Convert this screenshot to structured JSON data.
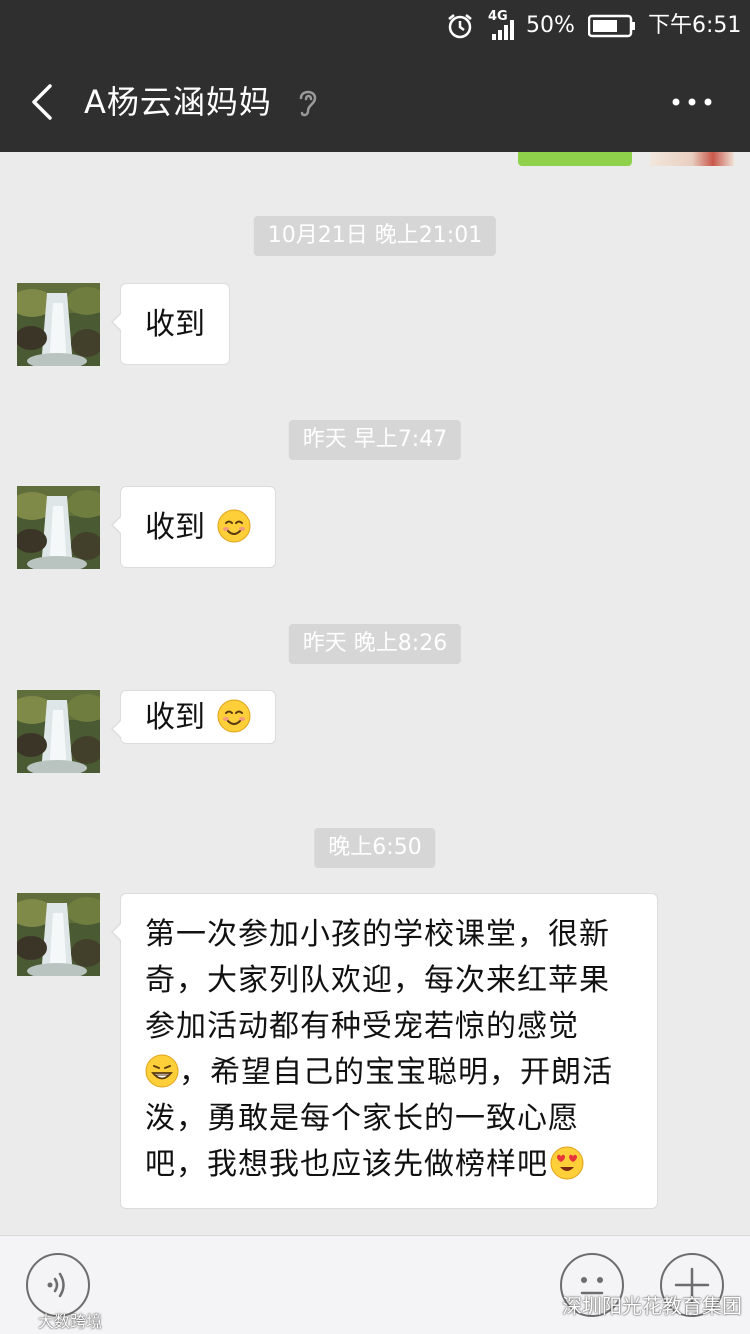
{
  "status_bar": {
    "network": "4G",
    "battery": "50%",
    "time": "下午6:51",
    "alarm_icon": "alarm-clock-icon",
    "signal_icon": "signal-icon",
    "battery_icon": "battery-icon"
  },
  "header": {
    "title": "A杨云涵妈妈",
    "back_icon": "back-arrow-icon",
    "ear_icon": "earpiece-mode-icon",
    "more_icon": "more-dots-icon"
  },
  "messages": {
    "ts1": "10月21日  晚上21:01",
    "m1": "收到",
    "ts2": "昨天  早上7:47",
    "m2": "收到",
    "ts3": "昨天  晚上8:26",
    "m3": "收到",
    "ts4": "晚上6:50",
    "m4_text_a": "第一次参加小孩的学校课堂，很新奇，大家列队欢迎，每次来红苹果参加活动都有种受宠若惊的感觉",
    "m4_text_b": "，希望自己的宝宝聪明，开朗活泼，勇敢是每个家长的一致心愿吧，我想我也应该先做榜样吧"
  },
  "input_bar": {
    "voice_icon": "voice-input-icon",
    "emoji_icon": "emoji-icon",
    "plus_icon": "plus-icon"
  },
  "watermarks": {
    "left": "大数跨境",
    "right": "深圳阳光花教育集团"
  },
  "colors": {
    "header_bg": "#2f2f2f",
    "chat_bg": "#ebebeb",
    "bubble_bg": "#ffffff",
    "timestamp_bg": "#d6d6d6",
    "sent_bubble": "#8fd14a"
  }
}
